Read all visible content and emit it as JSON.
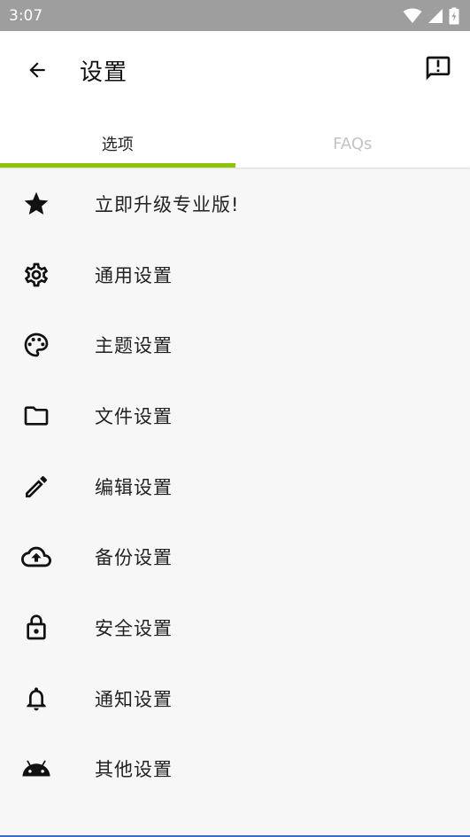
{
  "status_bar": {
    "time": "3:07",
    "icons": [
      "wifi-icon",
      "signal-icon",
      "battery-icon"
    ]
  },
  "app_bar": {
    "title": "设置",
    "back_icon": "arrow-back-icon",
    "action_icon": "feedback-icon"
  },
  "tabs": [
    {
      "label": "选项",
      "active": true
    },
    {
      "label": "FAQs",
      "active": false
    }
  ],
  "settings": [
    {
      "label": "立即升级专业版!",
      "icon": "star-icon"
    },
    {
      "label": "通用设置",
      "icon": "gear-icon"
    },
    {
      "label": "主题设置",
      "icon": "palette-icon"
    },
    {
      "label": "文件设置",
      "icon": "folder-icon"
    },
    {
      "label": "编辑设置",
      "icon": "pencil-icon"
    },
    {
      "label": "备份设置",
      "icon": "cloud-upload-icon"
    },
    {
      "label": "安全设置",
      "icon": "lock-icon"
    },
    {
      "label": "通知设置",
      "icon": "bell-icon"
    },
    {
      "label": "其他设置",
      "icon": "android-icon"
    }
  ],
  "colors": {
    "accent": "#8bc409",
    "status_bar": "#9e9e9e",
    "background": "#f7f7f7"
  }
}
